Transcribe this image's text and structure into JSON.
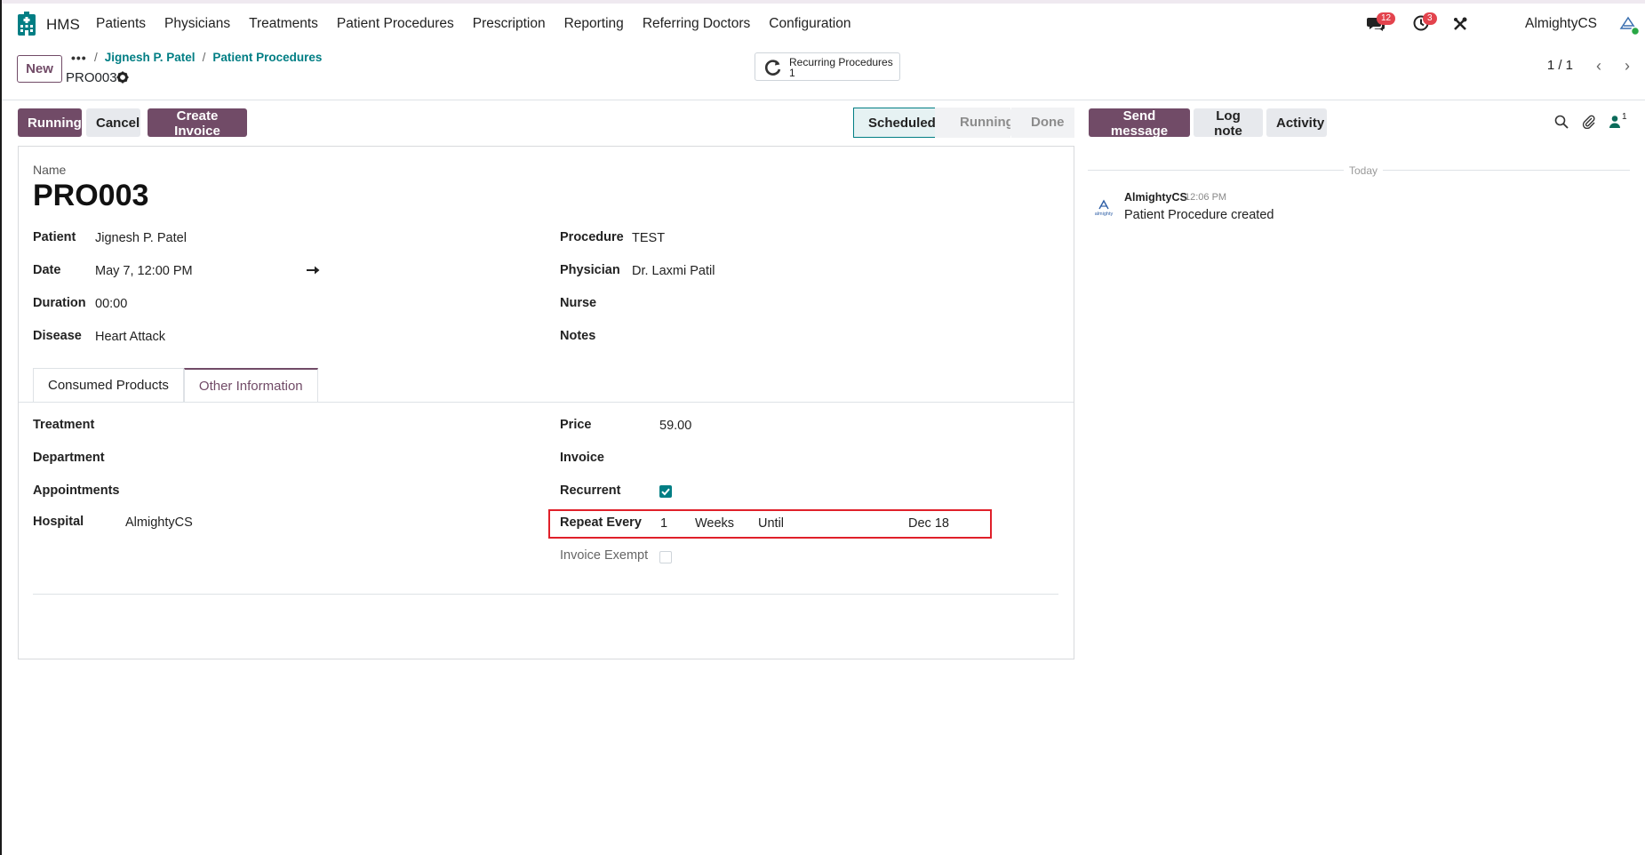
{
  "navbar": {
    "brand": "HMS",
    "menu": [
      "Patients",
      "Physicians",
      "Treatments",
      "Patient Procedures",
      "Prescription",
      "Reporting",
      "Referring Doctors",
      "Configuration"
    ],
    "messages_count": "12",
    "activities_count": "3",
    "company": "AlmightyCS",
    "icons": [
      "hospital-icon",
      "chat-icon",
      "clock-icon",
      "tools-icon",
      "avatar"
    ]
  },
  "control_panel": {
    "new_label": "New",
    "breadcrumbs": [
      "Jignesh P. Patel",
      "Patient Procedures"
    ],
    "record_title": "PRO003",
    "smart_button": {
      "label": "Recurring Procedures",
      "count": "1"
    },
    "pager": "1 / 1"
  },
  "actions": {
    "running": "Running",
    "cancel": "Cancel",
    "create_invoice": "Create Invoice"
  },
  "stages": [
    "Scheduled",
    "Running",
    "Done"
  ],
  "active_stage": "Scheduled",
  "form": {
    "name_label": "Name",
    "name": "PRO003",
    "left": [
      {
        "label": "Patient",
        "value": "Jignesh P. Patel"
      },
      {
        "label": "Date",
        "value": "May 7, 12:00 PM"
      },
      {
        "label": "Duration",
        "value": "00:00"
      },
      {
        "label": "Disease",
        "value": "Heart Attack"
      }
    ],
    "right": [
      {
        "label": "Procedure",
        "value": "TEST"
      },
      {
        "label": "Physician",
        "value": "Dr. Laxmi Patil"
      },
      {
        "label": "Nurse",
        "value": ""
      },
      {
        "label": "Notes",
        "value": ""
      }
    ],
    "tabs": [
      "Consumed Products",
      "Other Information"
    ],
    "active_tab": "Other Information",
    "other_left": [
      {
        "label": "Treatment",
        "value": ""
      },
      {
        "label": "Department",
        "value": ""
      },
      {
        "label": "Appointments",
        "value": ""
      },
      {
        "label": "Hospital",
        "value": "AlmightyCS"
      }
    ],
    "other_right": {
      "price_label": "Price",
      "price": "59.00",
      "invoice_label": "Invoice",
      "recurrent_label": "Recurrent",
      "recurrent": true,
      "repeat_label": "Repeat Every",
      "repeat_interval": "1",
      "repeat_unit": "Weeks",
      "until_label": "Until",
      "until_value": "Dec 18",
      "invoice_exempt_label": "Invoice Exempt",
      "invoice_exempt": false
    }
  },
  "chatter": {
    "send_message": "Send message",
    "log_note": "Log note",
    "activity": "Activity",
    "followers_count": "1",
    "date_separator": "Today",
    "messages": [
      {
        "author": "AlmightyCS",
        "time": "12:06 PM",
        "body": "Patient Procedure created",
        "avatar_text": "almighty"
      }
    ]
  },
  "colors": {
    "primary": "#714b67",
    "teal": "#017e84",
    "badge": "#e3434d",
    "highlight_border": "#e0202a"
  }
}
